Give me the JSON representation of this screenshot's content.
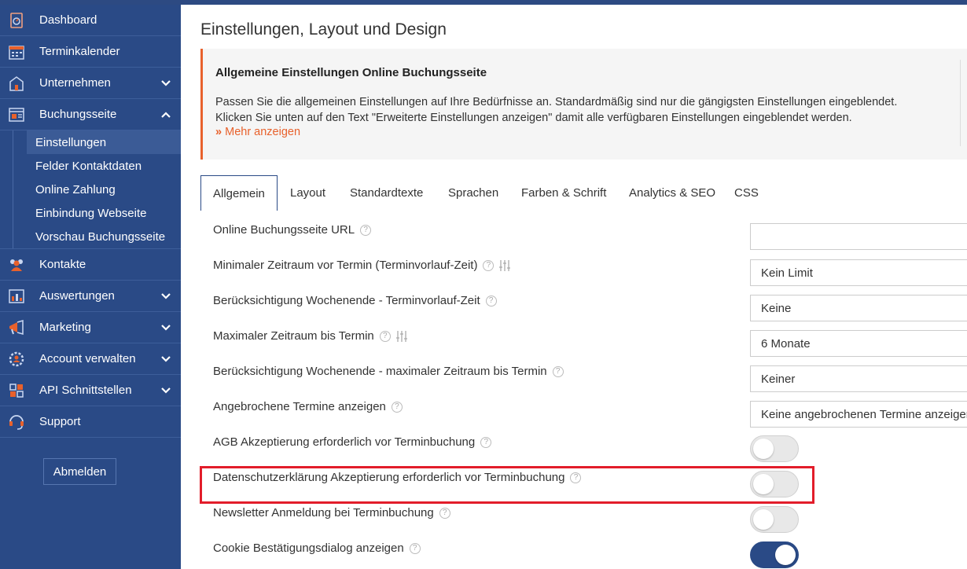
{
  "sidebar": {
    "items": [
      {
        "label": "Dashboard",
        "icon": "dashboard-icon"
      },
      {
        "label": "Terminkalender",
        "icon": "calendar-icon"
      },
      {
        "label": "Unternehmen",
        "icon": "building-icon"
      },
      {
        "label": "Buchungsseite",
        "icon": "booking-page-icon"
      },
      {
        "label": "Kontakte",
        "icon": "contacts-icon"
      },
      {
        "label": "Auswertungen",
        "icon": "reports-icon"
      },
      {
        "label": "Marketing",
        "icon": "marketing-icon"
      },
      {
        "label": "Account verwalten",
        "icon": "account-settings-icon"
      },
      {
        "label": "API Schnittstellen",
        "icon": "api-icon"
      },
      {
        "label": "Support",
        "icon": "support-icon"
      }
    ],
    "sub_items": [
      "Einstellungen",
      "Felder Kontaktdaten",
      "Online Zahlung",
      "Einbindung Webseite",
      "Vorschau Buchungsseite"
    ],
    "logout_label": "Abmelden"
  },
  "main": {
    "title": "Einstellungen, Layout und Design",
    "info": {
      "heading": "Allgemeine Einstellungen Online Buchungsseite",
      "line1": "Passen Sie die allgemeinen Einstellungen auf Ihre Bedürfnisse an. Standardmäßig sind nur die gängigsten Einstellungen eingeblendet.",
      "line2": "Klicken Sie unten auf den Text \"Erweiterte Einstellungen anzeigen\" damit alle verfügbaren Einstellungen eingeblendet werden.",
      "more": "Mehr anzeigen"
    },
    "tabs": [
      "Allgemein",
      "Layout",
      "Standardtexte",
      "Sprachen",
      "Farben & Schrift",
      "Analytics & SEO",
      "CSS"
    ],
    "settings": [
      {
        "label": "Online Buchungsseite URL",
        "value": ""
      },
      {
        "label": "Minimaler Zeitraum vor Termin (Terminvorlauf-Zeit)",
        "value": "Kein Limit"
      },
      {
        "label": "Berücksichtigung Wochenende - Terminvorlauf-Zeit",
        "value": "Keine"
      },
      {
        "label": "Maximaler Zeitraum bis Termin",
        "value": "6 Monate"
      },
      {
        "label": "Berücksichtigung Wochenende - maximaler Zeitraum bis Termin",
        "value": "Keiner"
      },
      {
        "label": "Angebrochene Termine anzeigen",
        "value": "Keine angebrochenen Termine anzeigen"
      },
      {
        "label": "AGB Akzeptierung erforderlich vor Terminbuchung",
        "toggle": false
      },
      {
        "label": "Datenschutzerklärung Akzeptierung erforderlich vor Terminbuchung",
        "toggle": false
      },
      {
        "label": "Newsletter Anmeldung bei Terminbuchung",
        "toggle": false
      },
      {
        "label": "Cookie Bestätigungsdialog anzeigen",
        "toggle": true
      }
    ],
    "help_glyph": "?"
  },
  "colors": {
    "sidebar": "#2a4a86",
    "accent": "#e8612c",
    "highlight": "#e21d2a"
  }
}
